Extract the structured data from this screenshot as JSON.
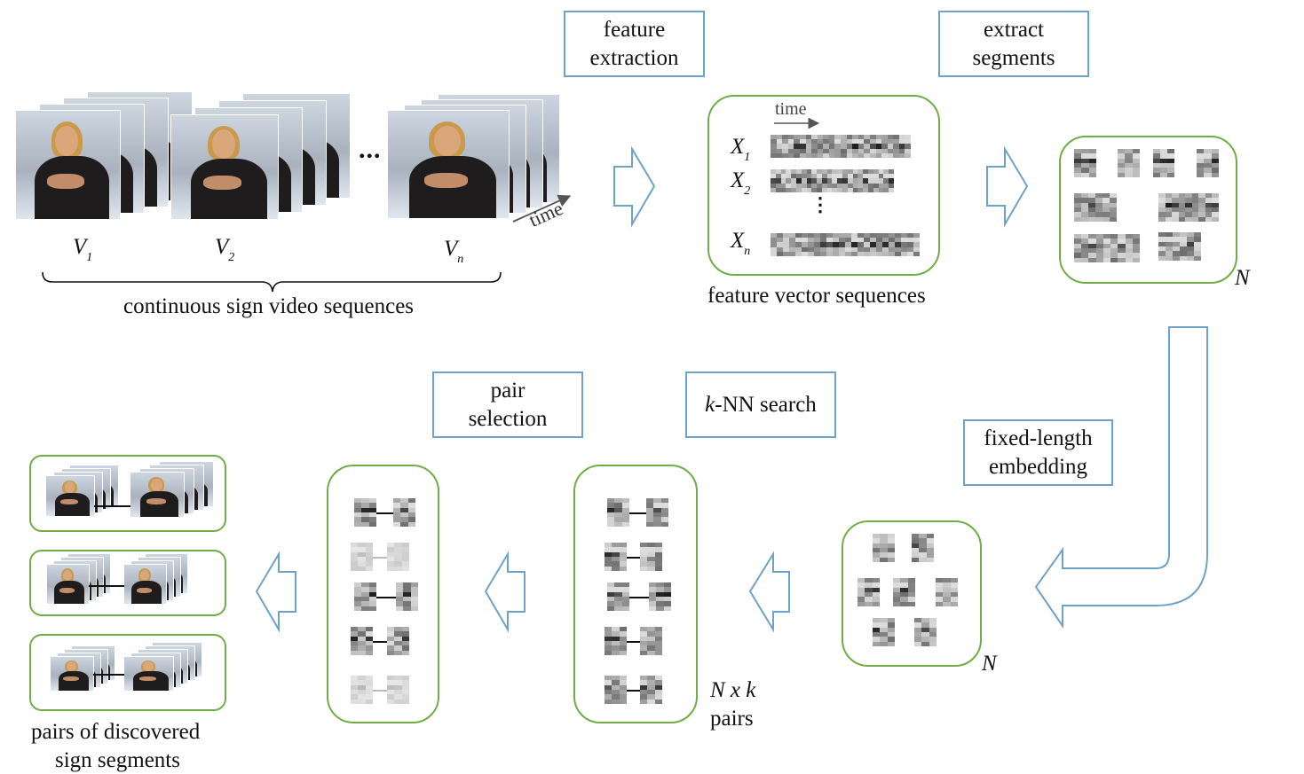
{
  "steps": {
    "feature_extraction": [
      "feature",
      "extraction"
    ],
    "extract_segments": [
      "extract",
      "segments"
    ],
    "fixed_length_embedding": [
      "fixed-length",
      "embedding"
    ],
    "knn_search": {
      "italic": "k",
      "rest": "-NN search"
    },
    "pair_selection": [
      "pair",
      "selection"
    ]
  },
  "videos": {
    "labels": [
      {
        "main": "V",
        "sub": "1"
      },
      {
        "main": "V",
        "sub": "2"
      },
      {
        "main": "V",
        "sub": "n"
      }
    ],
    "ellipsis": "...",
    "time_label": "time",
    "caption": "continuous sign video sequences"
  },
  "features": {
    "time_label": "time",
    "rows": [
      {
        "main": "X",
        "sub": "1"
      },
      {
        "main": "X",
        "sub": "2"
      },
      {
        "main": "X",
        "sub": "n"
      }
    ],
    "vdots": "⋮",
    "caption": "feature vector sequences"
  },
  "segments": {
    "count_label": "N"
  },
  "embeddings": {
    "count_label": "N"
  },
  "knn": {
    "count_line1": "N x k",
    "count_line2": "pairs"
  },
  "output": {
    "caption_line1": "pairs of discovered",
    "caption_line2": "sign segments"
  },
  "colors": {
    "step_border": "#6fa2c9",
    "group_border": "#70ad47",
    "arrow": "#6fa2c9"
  }
}
